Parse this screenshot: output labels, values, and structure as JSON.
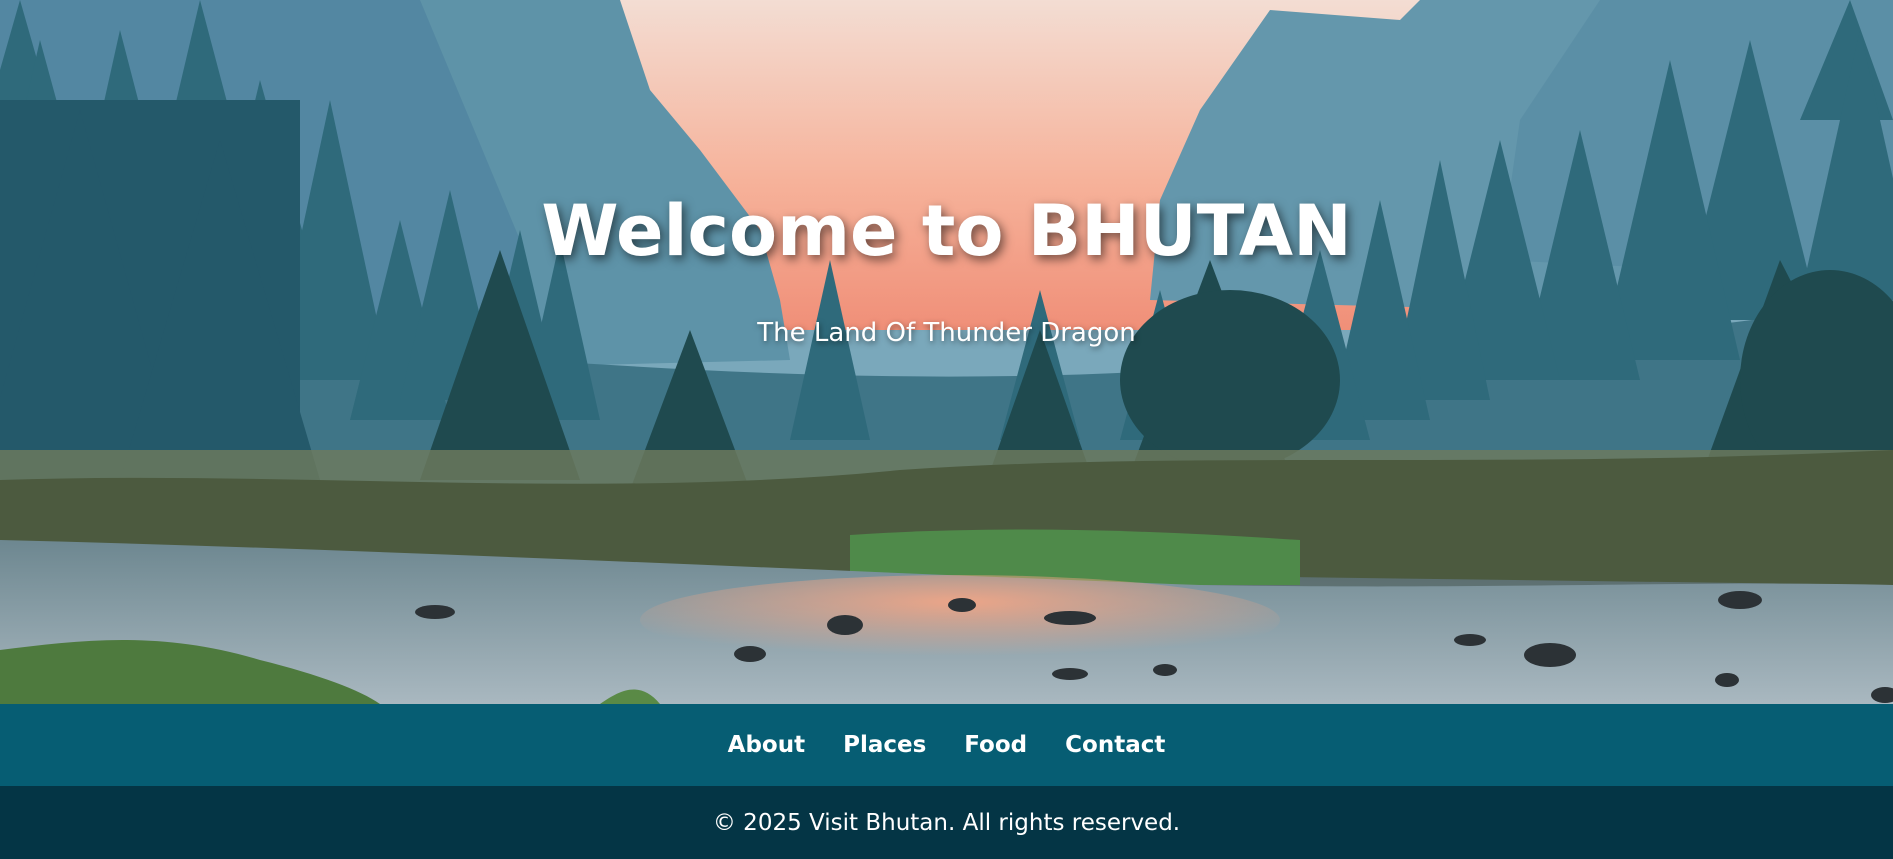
{
  "hero": {
    "title": "Welcome to BHUTAN",
    "subtitle": "The Land Of Thunder Dragon"
  },
  "nav": {
    "items": [
      {
        "label": "About"
      },
      {
        "label": "Places"
      },
      {
        "label": "Food"
      },
      {
        "label": "Contact"
      }
    ]
  },
  "footer": {
    "copyright": "© 2025 Visit Bhutan. All rights reserved."
  },
  "colors": {
    "nav_bg": "#065d73",
    "footer_bg": "#043545",
    "text": "#ffffff"
  }
}
